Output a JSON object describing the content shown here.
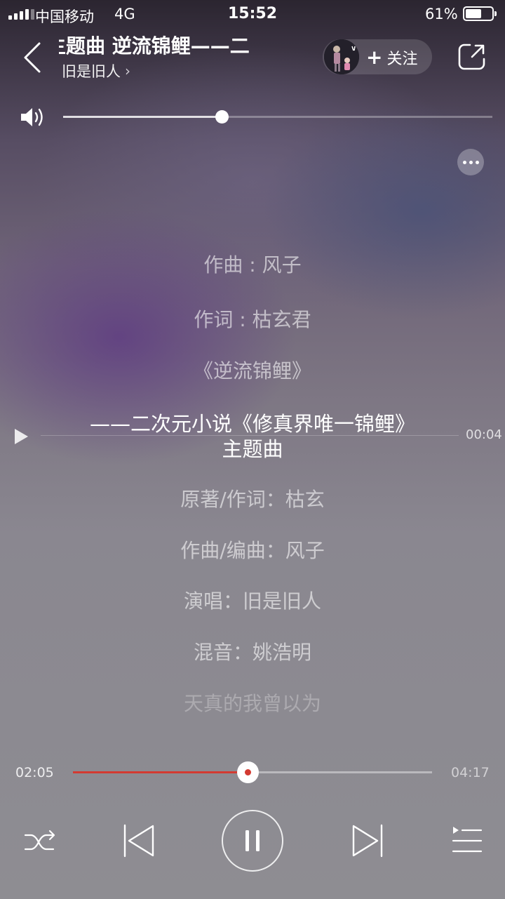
{
  "status_bar": {
    "carrier": "中国移动",
    "network": "4G",
    "time": "15:52",
    "battery_percent": "61%",
    "battery_level": 0.61
  },
  "header": {
    "title": "主题曲        逆流锦鲤——二",
    "artist": "旧是旧人",
    "follow_label": "关注",
    "icons": [
      "back-icon",
      "chevron-right-icon",
      "plus-icon",
      "share-icon"
    ]
  },
  "volume": {
    "level": 0.37,
    "icon": "speaker-icon"
  },
  "lyrics": [
    {
      "text": "作曲 : 风子",
      "state": "normal"
    },
    {
      "text": "作词 : 枯玄君",
      "state": "normal"
    },
    {
      "text": "《逆流锦鲤》",
      "state": "normal"
    },
    {
      "text": "——二次元小说《修真界唯一锦鲤》",
      "state": "current"
    },
    {
      "text": "主题曲",
      "state": "current"
    },
    {
      "text": "原著/作词：枯玄",
      "state": "normal"
    },
    {
      "text": "作曲/编曲：风子",
      "state": "normal"
    },
    {
      "text": "演唱：旧是旧人",
      "state": "normal"
    },
    {
      "text": "混音：姚浩明",
      "state": "normal"
    },
    {
      "text": "天真的我曾以为",
      "state": "fade"
    }
  ],
  "lyric_seek": {
    "time": "00:04"
  },
  "player": {
    "current_time": "02:05",
    "total_time": "04:17",
    "progress": 0.486,
    "accent_color": "#d33a31",
    "controls": [
      "shuffle-icon",
      "previous-icon",
      "pause-icon",
      "next-icon",
      "queue-icon"
    ]
  }
}
